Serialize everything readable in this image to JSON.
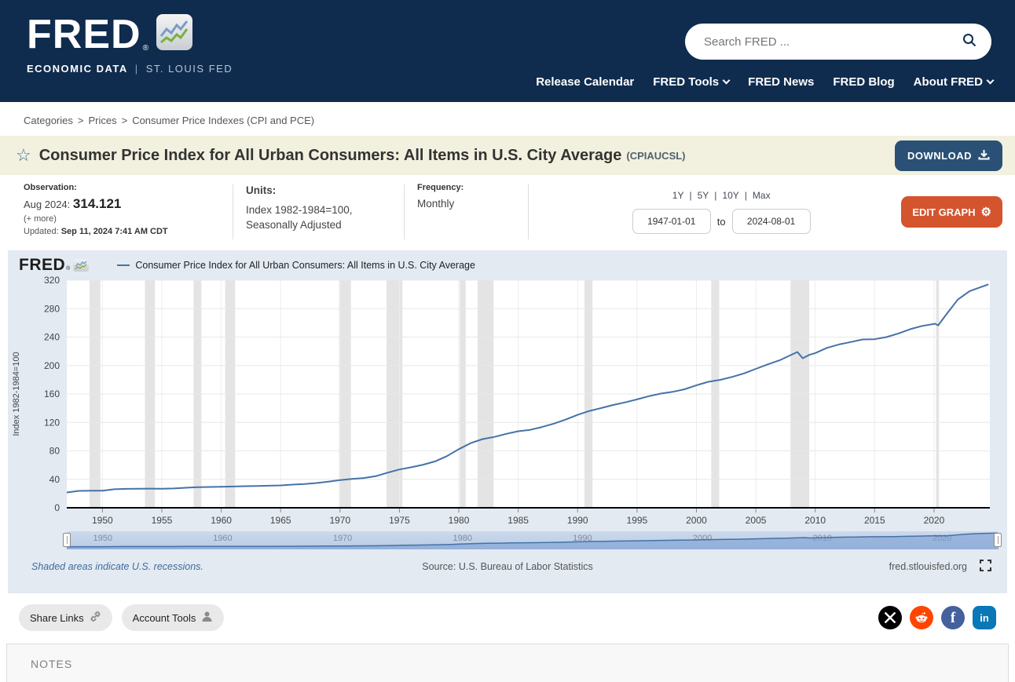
{
  "header": {
    "logo_text": "FRED",
    "logo_registered": "®",
    "logo_tagline_left": "ECONOMIC DATA",
    "tagline_separator": "|",
    "logo_tagline_right": "ST. LOUIS FED",
    "search_placeholder": "Search FRED ...",
    "nav": [
      {
        "label": "Release Calendar"
      },
      {
        "label": "FRED Tools"
      },
      {
        "label": "FRED News"
      },
      {
        "label": "FRED Blog"
      },
      {
        "label": "About FRED"
      }
    ]
  },
  "breadcrumb": {
    "separator": ">",
    "items": [
      "Categories",
      "Prices",
      "Consumer Price Indexes (CPI and PCE)"
    ]
  },
  "series_header": {
    "title": "Consumer Price Index for All Urban Consumers: All Items in U.S. City Average",
    "series_id": "(CPIAUCSL)",
    "download_label": "DOWNLOAD"
  },
  "meta": {
    "observation_label": "Observation:",
    "observation_date": "Aug 2024:",
    "observation_value": "314.121",
    "more_label": "(+ more)",
    "updated_label": "Updated:",
    "updated_value": "Sep 11, 2024 7:41 AM CDT",
    "units_label": "Units:",
    "units_line1": "Index 1982-1984=100,",
    "units_line2": "Seasonally Adjusted",
    "frequency_label": "Frequency:",
    "frequency_value": "Monthly",
    "presets": [
      "1Y",
      "5Y",
      "10Y",
      "Max"
    ],
    "presets_separator": "|",
    "date_start": "1947-01-01",
    "to_label": "to",
    "date_end": "2024-08-01",
    "edit_graph_label": "EDIT GRAPH"
  },
  "chart_data": {
    "type": "line",
    "title": "Consumer Price Index for All Urban Consumers: All Items in U.S. City Average",
    "legend": "Consumer Price Index for All Urban Consumers: All Items in U.S. City Average",
    "watermark": "FRED",
    "ylabel": "Index 1982-1984=100",
    "ylim": [
      0,
      320
    ],
    "ytick_step": 40,
    "xlim": [
      1947,
      2024.7
    ],
    "xticks": [
      1950,
      1955,
      1960,
      1965,
      1970,
      1975,
      1980,
      1985,
      1990,
      1995,
      2000,
      2005,
      2010,
      2015,
      2020
    ],
    "slider_labels": [
      1950,
      1960,
      1970,
      1980,
      1990,
      2000,
      2010,
      2020
    ],
    "grid": true,
    "legend_position": "top",
    "series": [
      {
        "name": "Consumer Price Index for All Urban Consumers: All Items in U.S. City Average",
        "color": "#4572a7",
        "points": [
          [
            1947,
            21.5
          ],
          [
            1948,
            23.7
          ],
          [
            1949,
            23.9
          ],
          [
            1950,
            24.1
          ],
          [
            1951,
            26.0
          ],
          [
            1952,
            26.6
          ],
          [
            1953,
            26.8
          ],
          [
            1954,
            26.9
          ],
          [
            1955,
            26.8
          ],
          [
            1956,
            27.2
          ],
          [
            1957,
            28.1
          ],
          [
            1958,
            28.9
          ],
          [
            1959,
            29.2
          ],
          [
            1960,
            29.6
          ],
          [
            1961,
            29.9
          ],
          [
            1962,
            30.3
          ],
          [
            1963,
            30.6
          ],
          [
            1964,
            31.0
          ],
          [
            1965,
            31.5
          ],
          [
            1966,
            32.5
          ],
          [
            1967,
            33.4
          ],
          [
            1968,
            34.8
          ],
          [
            1969,
            36.7
          ],
          [
            1970,
            38.8
          ],
          [
            1971,
            40.5
          ],
          [
            1972,
            41.8
          ],
          [
            1973,
            44.4
          ],
          [
            1974,
            49.3
          ],
          [
            1975,
            53.8
          ],
          [
            1976,
            56.9
          ],
          [
            1977,
            60.6
          ],
          [
            1978,
            65.2
          ],
          [
            1979,
            72.6
          ],
          [
            1980,
            82.4
          ],
          [
            1981,
            90.9
          ],
          [
            1982,
            96.5
          ],
          [
            1983,
            99.6
          ],
          [
            1984,
            103.9
          ],
          [
            1985,
            107.6
          ],
          [
            1986,
            109.6
          ],
          [
            1987,
            113.6
          ],
          [
            1988,
            118.3
          ],
          [
            1989,
            124.0
          ],
          [
            1990,
            130.7
          ],
          [
            1991,
            136.2
          ],
          [
            1992,
            140.3
          ],
          [
            1993,
            144.5
          ],
          [
            1994,
            148.2
          ],
          [
            1995,
            152.4
          ],
          [
            1996,
            156.9
          ],
          [
            1997,
            160.5
          ],
          [
            1998,
            163.0
          ],
          [
            1999,
            166.6
          ],
          [
            2000,
            172.2
          ],
          [
            2001,
            177.1
          ],
          [
            2002,
            179.9
          ],
          [
            2003,
            184.0
          ],
          [
            2004,
            188.9
          ],
          [
            2005,
            195.3
          ],
          [
            2006,
            201.6
          ],
          [
            2007,
            207.3
          ],
          [
            2008.5,
            219.0
          ],
          [
            2008.95,
            210.2
          ],
          [
            2009.5,
            215.0
          ],
          [
            2010,
            217.5
          ],
          [
            2011,
            224.9
          ],
          [
            2012,
            229.6
          ],
          [
            2013,
            233.0
          ],
          [
            2014,
            236.7
          ],
          [
            2015,
            237.0
          ],
          [
            2016,
            240.0
          ],
          [
            2017,
            245.1
          ],
          [
            2018,
            251.1
          ],
          [
            2019,
            255.7
          ],
          [
            2020.1,
            258.8
          ],
          [
            2020.35,
            256.4
          ],
          [
            2021,
            271.0
          ],
          [
            2022,
            292.7
          ],
          [
            2023,
            304.7
          ],
          [
            2024.58,
            314.121
          ]
        ]
      }
    ],
    "recessions": [
      [
        1948.92,
        1949.83
      ],
      [
        1953.58,
        1954.42
      ],
      [
        1957.67,
        1958.33
      ],
      [
        1960.33,
        1961.17
      ],
      [
        1969.92,
        1970.92
      ],
      [
        1973.92,
        1975.25
      ],
      [
        1980.08,
        1980.58
      ],
      [
        1981.58,
        1982.92
      ],
      [
        1990.58,
        1991.25
      ],
      [
        2001.25,
        2001.92
      ],
      [
        2007.92,
        2009.5
      ],
      [
        2020.17,
        2020.42
      ]
    ],
    "footnote": "Shaded areas indicate U.S. recessions.",
    "source": "Source: U.S. Bureau of Labor Statistics",
    "site": "fred.stlouisfed.org"
  },
  "footer": {
    "share_links_label": "Share Links",
    "account_tools_label": "Account Tools"
  },
  "notes": {
    "label": "NOTES"
  },
  "colors": {
    "header_navy": "#0f2c4e",
    "title_bar_cream": "#f2f1df",
    "download_navy": "#2a5175",
    "edit_orange": "#d4542e",
    "chart_bg": "#e3eaf2",
    "line_blue": "#4572a7",
    "recession_gray": "#e4e4e4",
    "slider_track": "#b7cae4",
    "social_x": "#000000",
    "social_reddit": "#ff4500",
    "social_facebook": "#44619d",
    "social_linkedin": "#0a77b6"
  }
}
